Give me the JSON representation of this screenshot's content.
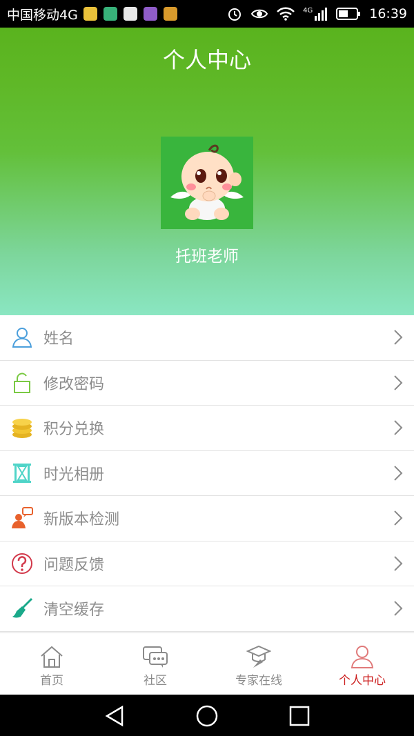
{
  "status_bar": {
    "carrier": "中国移动4G",
    "network": "4G",
    "time": "16:39"
  },
  "header": {
    "title": "个人中心",
    "username": "托班老师"
  },
  "menu": [
    {
      "label": "姓名",
      "icon": "user-icon"
    },
    {
      "label": "修改密码",
      "icon": "unlock-icon"
    },
    {
      "label": "积分兑换",
      "icon": "coins-icon"
    },
    {
      "label": "时光相册",
      "icon": "hourglass-icon"
    },
    {
      "label": "新版本检测",
      "icon": "person-speech-icon"
    },
    {
      "label": "问题反馈",
      "icon": "question-icon"
    },
    {
      "label": "清空缓存",
      "icon": "broom-icon"
    }
  ],
  "tabs": [
    {
      "label": "首页",
      "icon": "home-icon",
      "active": false
    },
    {
      "label": "社区",
      "icon": "chat-icon",
      "active": false
    },
    {
      "label": "专家在线",
      "icon": "graduation-cap-icon",
      "active": false
    },
    {
      "label": "个人中心",
      "icon": "user-icon",
      "active": true
    }
  ],
  "colors": {
    "header_top": "#5ab31e",
    "header_bottom": "#8ae6c2",
    "avatar_bg": "#39b53d",
    "active_tab": "#cc1f1f",
    "menu_text": "#8c8c8c"
  }
}
